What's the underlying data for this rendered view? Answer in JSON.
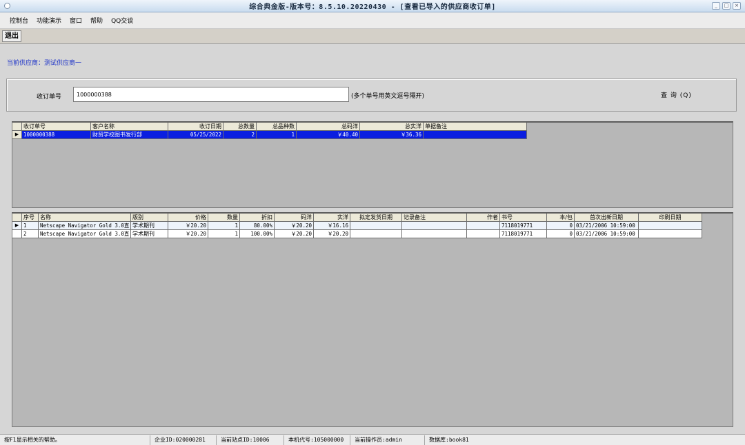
{
  "window": {
    "title": "综合典金版-版本号：8.5.10.20220430 - [查看已导入的供应商收订单]",
    "controls": [
      "_",
      "□",
      "×"
    ]
  },
  "menu": [
    "控制台",
    "功能演示",
    "窗口",
    "帮助",
    "QQ交谈"
  ],
  "toolbar": {
    "exit_label": "退出"
  },
  "supplier": {
    "label": "当前供应商：测试供应商一"
  },
  "query": {
    "label": "收订单号",
    "value": "1000000388",
    "hint": "(多个单号用英文逗号隔开)",
    "button": "查 询 (Q)"
  },
  "orders": {
    "columns": [
      "收订单号",
      "客户名称",
      "收订日期",
      "总数量",
      "总品种数",
      "总码洋",
      "总实洋",
      "单据备注"
    ],
    "rows": [
      [
        "1000000388",
        "财贸学校图书发行部",
        "05/25/2022",
        "2",
        "1",
        "￥40.40",
        "￥36.36",
        ""
      ]
    ]
  },
  "details": {
    "columns": [
      "序号",
      "名称",
      "版别",
      "价格",
      "数量",
      "折扣",
      "码洋",
      "实洋",
      "拟定发货日期",
      "记录备注",
      "作者",
      "书号",
      "本/包",
      "首次出新日期",
      "印刷日期"
    ],
    "rows": [
      [
        "1",
        "Netscape Navigator Gold 3.0直",
        "学术期刊",
        "￥20.20",
        "1",
        "80.00%",
        "￥20.20",
        "￥16.16",
        "",
        "",
        "",
        "7118019771",
        "0",
        "03/21/2006 10:59:00",
        ""
      ],
      [
        "2",
        "Netscape Navigator Gold 3.0直",
        "学术期刊",
        "￥20.20",
        "1",
        "100.00%",
        "￥20.20",
        "￥20.20",
        "",
        "",
        "",
        "7118019771",
        "0",
        "03/21/2006 10:59:00",
        ""
      ]
    ]
  },
  "status": {
    "help": "按F1显示相关的帮助。",
    "company": "企业ID:020000281",
    "site": "当前站点ID:10006",
    "machine": "本机代号:105000000",
    "operator": "当前操作员:admin",
    "database": "数据库:book81"
  }
}
